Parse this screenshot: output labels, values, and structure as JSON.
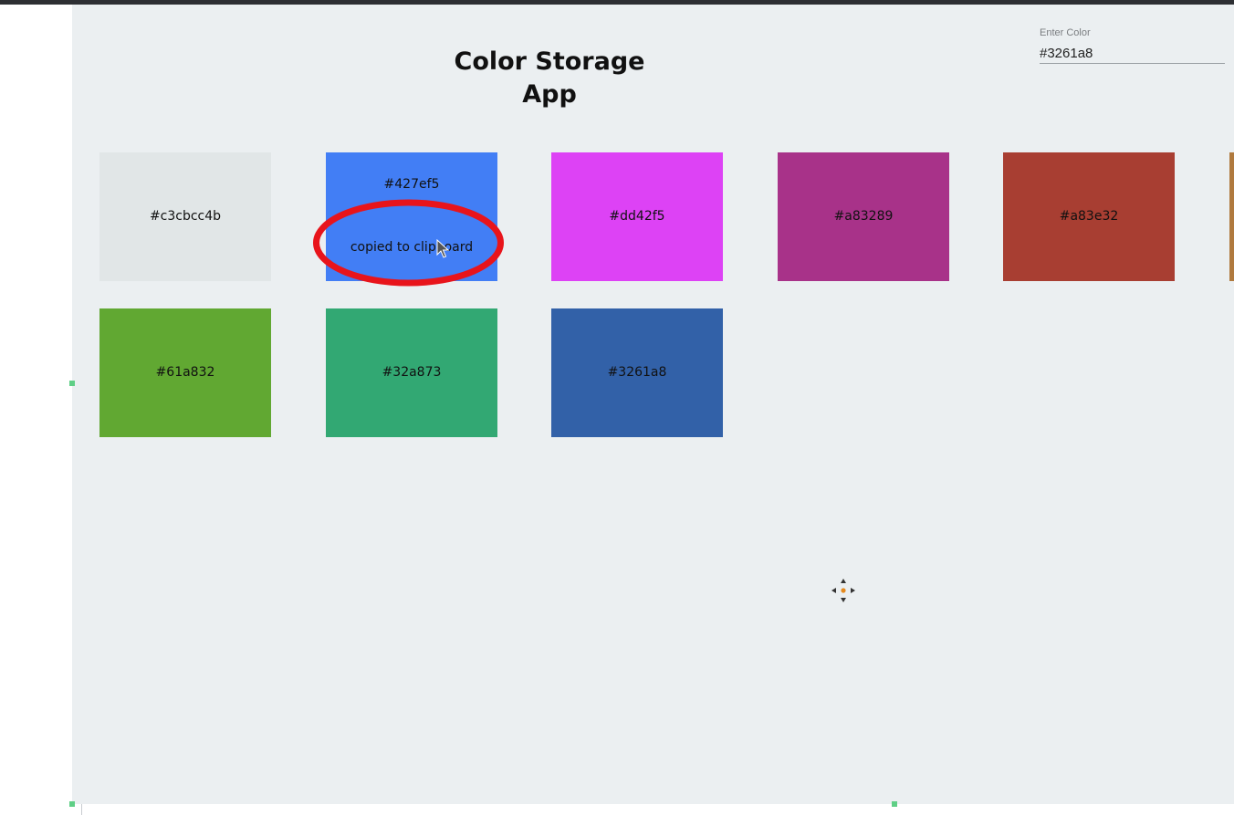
{
  "app": {
    "title": "Color Storage App"
  },
  "color_input": {
    "label": "Enter Color",
    "value": "#3261a8"
  },
  "swatches": [
    {
      "hex": "#c3cbcc4b",
      "fill": "#e1e6e7"
    },
    {
      "hex": "#427ef5",
      "fill": "#427ef5",
      "message": "copied to clipboard"
    },
    {
      "hex": "#dd42f5",
      "fill": "#dd42f5"
    },
    {
      "hex": "#a83289",
      "fill": "#a83289"
    },
    {
      "hex": "#a83e32",
      "fill": "#a83e32"
    },
    {
      "hex": "#61a832",
      "fill": "#61a832"
    },
    {
      "hex": "#32a873",
      "fill": "#32a873"
    },
    {
      "hex": "#3261a8",
      "fill": "#3261a8"
    }
  ],
  "partial_swatch": {
    "fill": "#b07a3e"
  },
  "colors": {
    "background": "#ebeff1",
    "annotation": "#e8141b",
    "handle": "#5fcf86"
  }
}
